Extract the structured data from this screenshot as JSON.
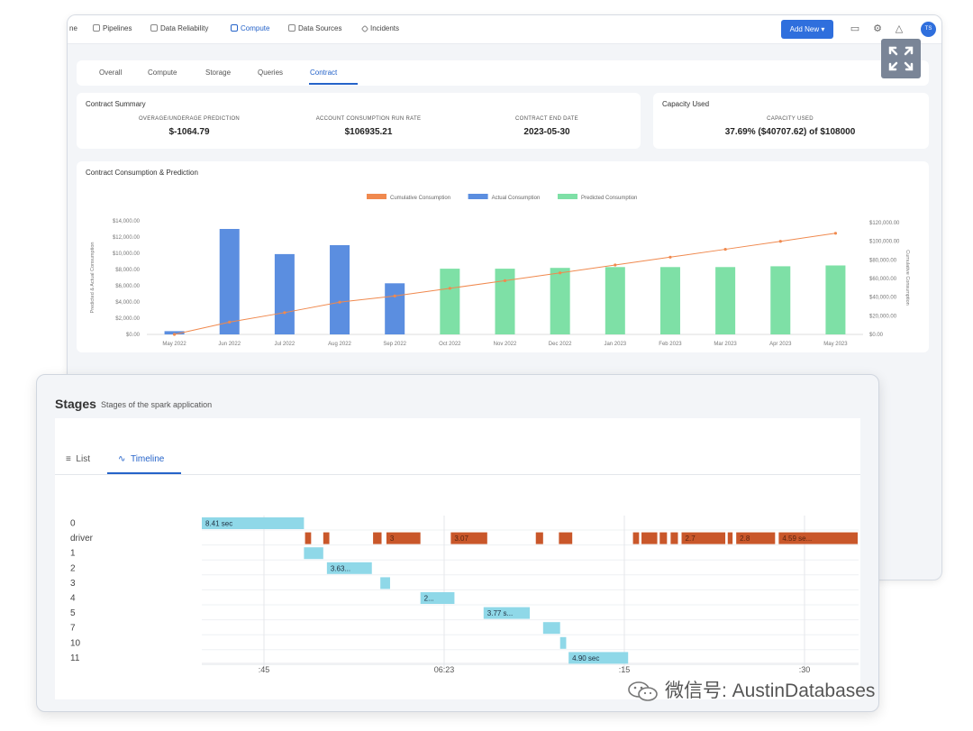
{
  "nav": {
    "items": [
      {
        "label": "ne",
        "active": false
      },
      {
        "label": "Pipelines",
        "active": false
      },
      {
        "label": "Data Reliability",
        "active": false
      },
      {
        "label": "Compute",
        "active": true
      },
      {
        "label": "Data Sources",
        "active": false
      },
      {
        "label": "Incidents",
        "active": false
      }
    ],
    "add_new": "Add New ▾",
    "avatar": "TS"
  },
  "subtabs": [
    "Overall",
    "Compute",
    "Storage",
    "Queries",
    "Contract"
  ],
  "contract_summary": {
    "title": "Contract Summary",
    "metrics": [
      {
        "label": "OVERAGE/UNDERAGE PREDICTION",
        "value": "$-1064.79"
      },
      {
        "label": "ACCOUNT CONSUMPTION RUN RATE",
        "value": "$106935.21"
      },
      {
        "label": "CONTRACT END DATE",
        "value": "2023-05-30"
      }
    ]
  },
  "capacity": {
    "title": "Capacity Used",
    "label": "CAPACITY USED",
    "value": "37.69% ($40707.62) of $108000"
  },
  "chart_data": {
    "type": "bar",
    "title": "Contract Consumption & Prediction",
    "legend": [
      "Cumulative Consumption",
      "Actual Consumption",
      "Predicted Consumption"
    ],
    "legend_position": "top",
    "ylabel": "Predicted & Actual Consumption",
    "y2label": "Cumulative Consumption",
    "categories": [
      "May 2022",
      "Jun 2022",
      "Jul 2022",
      "Aug 2022",
      "Sep 2022",
      "Oct 2022",
      "Nov 2022",
      "Dec 2022",
      "Jan 2023",
      "Feb 2023",
      "Mar 2023",
      "Apr 2023",
      "May 2023"
    ],
    "yticks": [
      "$14,000.00",
      "$12,000.00",
      "$10,000.00",
      "$8,000.00",
      "$6,000.00",
      "$4,000.00",
      "$2,000.00",
      "$0.00"
    ],
    "y2ticks": [
      "$120,000.00",
      "$100,000.00",
      "$80,000.00",
      "$60,000.00",
      "$40,000.00",
      "$20,000.00",
      "$0.00"
    ],
    "ylim": [
      0,
      14000
    ],
    "y2lim": [
      0,
      120000
    ],
    "series": [
      {
        "name": "Actual Consumption",
        "color": "#5b8ee0",
        "values": [
          400,
          13000,
          9900,
          11000,
          6300,
          null,
          null,
          null,
          null,
          null,
          null,
          null,
          null
        ]
      },
      {
        "name": "Predicted Consumption",
        "color": "#7ee0a6",
        "values": [
          null,
          null,
          null,
          null,
          null,
          8100,
          8100,
          8200,
          8300,
          8300,
          8300,
          8400,
          8500
        ]
      },
      {
        "name": "Cumulative Consumption",
        "color": "#f0894e",
        "values": [
          0,
          13000,
          23000,
          34000,
          40500,
          48600,
          56700,
          64900,
          73200,
          81500,
          89800,
          98200,
          106700
        ]
      }
    ]
  },
  "stages": {
    "title": "Stages",
    "subtitle": "Stages of the spark application",
    "tabs": [
      "List",
      "Timeline"
    ],
    "rows": [
      "0",
      "driver",
      "1",
      "2",
      "3",
      "4",
      "5",
      "7",
      "10",
      "11"
    ],
    "xticks": [
      ":45",
      "06:23",
      ":15",
      ":30"
    ],
    "bars": [
      {
        "row": 0,
        "start": 0.0,
        "end": 8.41,
        "label": "8.41 sec",
        "color": "#8fd8e8"
      },
      {
        "row": 2,
        "start": 8.41,
        "end": 10.0,
        "label": "",
        "color": "#8fd8e8"
      },
      {
        "row": 3,
        "start": 10.3,
        "end": 14.0,
        "label": "3.63...",
        "color": "#8fd8e8"
      },
      {
        "row": 4,
        "start": 14.7,
        "end": 15.5,
        "label": "",
        "color": "#8fd8e8"
      },
      {
        "row": 5,
        "start": 18.0,
        "end": 20.8,
        "label": "2...",
        "color": "#8fd8e8"
      },
      {
        "row": 6,
        "start": 23.2,
        "end": 27.0,
        "label": "3.77 s...",
        "color": "#8fd8e8"
      },
      {
        "row": 7,
        "start": 28.1,
        "end": 29.5,
        "label": "",
        "color": "#8fd8e8"
      },
      {
        "row": 8,
        "start": 29.5,
        "end": 30.0,
        "label": "",
        "color": "#8fd8e8"
      },
      {
        "row": 9,
        "start": 30.2,
        "end": 35.1,
        "label": "4.90 sec",
        "color": "#8fd8e8"
      },
      {
        "row": 1,
        "start": 8.5,
        "end": 9.0,
        "label": "",
        "color": "#c9572a"
      },
      {
        "row": 1,
        "start": 10.0,
        "end": 10.5,
        "label": "",
        "color": "#c9572a"
      },
      {
        "row": 1,
        "start": 14.1,
        "end": 14.8,
        "label": "",
        "color": "#c9572a"
      },
      {
        "row": 1,
        "start": 15.2,
        "end": 18.0,
        "label": "3",
        "color": "#c9572a"
      },
      {
        "row": 1,
        "start": 20.5,
        "end": 23.5,
        "label": "3.07",
        "color": "#c9572a"
      },
      {
        "row": 1,
        "start": 27.5,
        "end": 28.1,
        "label": "",
        "color": "#c9572a"
      },
      {
        "row": 1,
        "start": 29.4,
        "end": 30.5,
        "label": "",
        "color": "#c9572a"
      },
      {
        "row": 1,
        "start": 35.5,
        "end": 36.0,
        "label": "",
        "color": "#c9572a"
      },
      {
        "row": 1,
        "start": 36.2,
        "end": 37.5,
        "label": "",
        "color": "#c9572a"
      },
      {
        "row": 1,
        "start": 37.7,
        "end": 38.3,
        "label": "",
        "color": "#c9572a"
      },
      {
        "row": 1,
        "start": 38.6,
        "end": 39.2,
        "label": "",
        "color": "#c9572a"
      },
      {
        "row": 1,
        "start": 39.5,
        "end": 43.1,
        "label": "2.7",
        "color": "#c9572a"
      },
      {
        "row": 1,
        "start": 43.3,
        "end": 43.7,
        "label": "",
        "color": "#c9572a"
      },
      {
        "row": 1,
        "start": 44.0,
        "end": 47.2,
        "label": "2.8",
        "color": "#c9572a"
      },
      {
        "row": 1,
        "start": 47.5,
        "end": 54.0,
        "label": "4.59 se...",
        "color": "#c9572a"
      }
    ]
  },
  "watermark": "微信号: AustinDatabases"
}
